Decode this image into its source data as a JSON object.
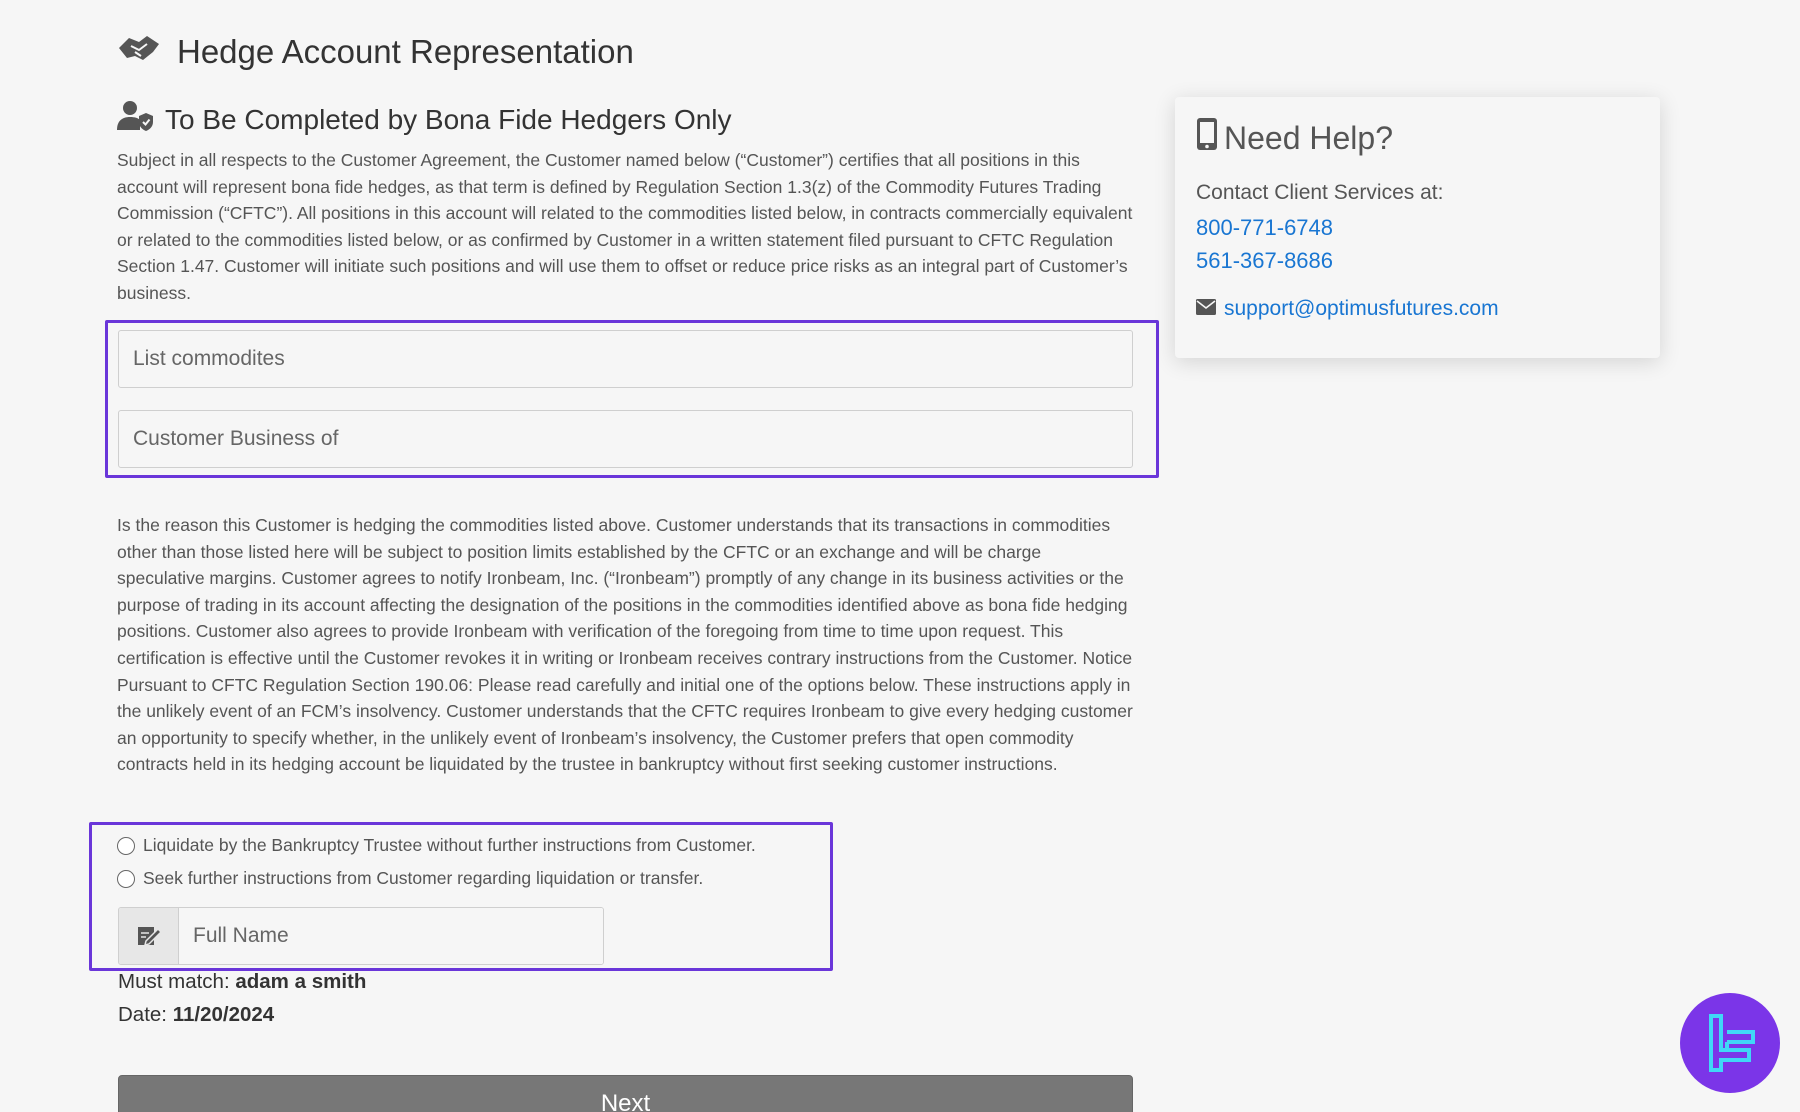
{
  "header": {
    "title": "Hedge Account Representation",
    "title_icon": "handshake-icon"
  },
  "section": {
    "title": "To Be Completed by Bona Fide Hedgers Only",
    "icon": "user-shield-icon",
    "paragraph1": "Subject in all respects to the Customer Agreement, the Customer named below (“Customer”) certifies that all positions in this account will represent bona fide hedges, as that term is defined by Regulation Section 1.3(z) of the Commodity Futures Trading Commission (“CFTC”). All positions in this account will related to the commodities listed below, in contracts commercially equivalent or related to the commodities listed below, or as confirmed by Customer in a written statement filed pursuant to CFTC Regulation Section 1.47. Customer will initiate such positions and will use them to offset or reduce price risks as an integral part of Customer’s business.",
    "paragraph2": "Is the reason this Customer is hedging the commodities listed above. Customer understands that its transactions in commodities other than those listed here will be subject to position limits established by the CFTC or an exchange and will be charge speculative margins. Customer agrees to notify Ironbeam, Inc. (“Ironbeam”) promptly of any change in its business activities or the purpose of trading in its account affecting the designation of the positions in the commodities identified above as bona fide hedging positions. Customer also agrees to provide Ironbeam with verification of the foregoing from time to time upon request. This certification is effective until the Customer revokes it in writing or Ironbeam receives contrary instructions from the Customer. Notice Pursuant to CFTC Regulation Section 190.06: Please read carefully and initial one of the options below. These instructions apply in the unlikely event of an FCM’s insolvency. Customer understands that the CFTC requires Ironbeam to give every hedging customer an opportunity to specify whether, in the unlikely event of Ironbeam’s insolvency, the Customer prefers that open commodity contracts held in its hedging account be liquidated by the trustee in bankruptcy without first seeking customer instructions."
  },
  "form": {
    "commodities": {
      "placeholder": "List commodites",
      "value": ""
    },
    "business": {
      "placeholder": "Customer Business of",
      "value": ""
    },
    "radio_options": [
      {
        "label": "Liquidate by the Bankruptcy Trustee without further instructions from Customer.",
        "selected": false
      },
      {
        "label": "Seek further instructions from Customer regarding liquidation or transfer.",
        "selected": false
      }
    ],
    "signature": {
      "placeholder": "Full Name",
      "icon": "signature-icon",
      "value": ""
    },
    "must_match_label": "Must match:",
    "must_match_value": "adam a smith",
    "date_label": "Date:",
    "date_value": "11/20/2024",
    "next_label": "Next"
  },
  "help": {
    "title": "Need Help?",
    "icon": "mobile-phone-icon",
    "contact_label": "Contact Client Services at:",
    "phones": [
      "800-771-6748",
      "561-367-8686"
    ],
    "email_icon": "envelope-icon",
    "email": "support@optimusfutures.com"
  },
  "colors": {
    "highlight": "#6a36d9",
    "link": "#1976d2",
    "button": "#777777",
    "badge": "#7b35e8"
  }
}
